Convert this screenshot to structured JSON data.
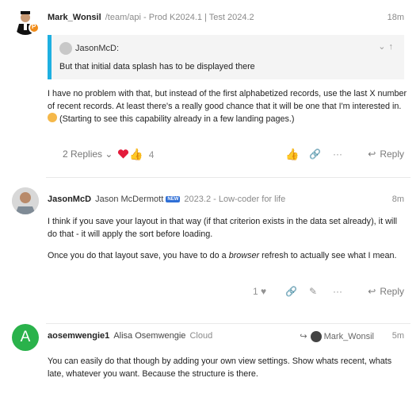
{
  "posts": [
    {
      "username": "Mark_Wonsil",
      "title": "/team/api - Prod K2024.1 | Test 2024.2",
      "age": "18m",
      "quote": {
        "author": "JasonMcD:",
        "text": "But that initial data splash has to be displayed there"
      },
      "text": "I have no problem with that, but instead of the first alphabetized records, use the last X number of recent records. At least there's a really good chance that it will be one that I'm interested in.",
      "text2": "(Starting to see this capability already in a few landing pages.)",
      "replies_label": "2 Replies",
      "reaction_count": "4",
      "reply_label": "Reply"
    },
    {
      "username": "JasonMcD",
      "full_name": "Jason McDermott",
      "badge": "NEW",
      "title": "2023.2 - Low-coder for life",
      "age": "8m",
      "para1": "I think if you save your layout in that way (if that criterion exists in the data set already), it will do that - it will apply the sort before loading.",
      "para2_a": "Once you do that layout save, you have to do a ",
      "para2_em": "browser",
      "para2_b": " refresh to actually see what I mean.",
      "like_count": "1",
      "reply_label": "Reply"
    },
    {
      "avatar_letter": "A",
      "username": "aosemwengie1",
      "full_name": "Alisa Osemwengie",
      "title": "Cloud",
      "reply_to": "Mark_Wonsil",
      "age": "5m",
      "text": "You can easily do that though by adding your own view settings. Show whats recent, whats late, whatever you want. Because the structure is there."
    }
  ],
  "colors": {
    "quote_border": "#1eb0e1",
    "heart": "#e31b3b",
    "avatar_a": "#2ab24b"
  }
}
